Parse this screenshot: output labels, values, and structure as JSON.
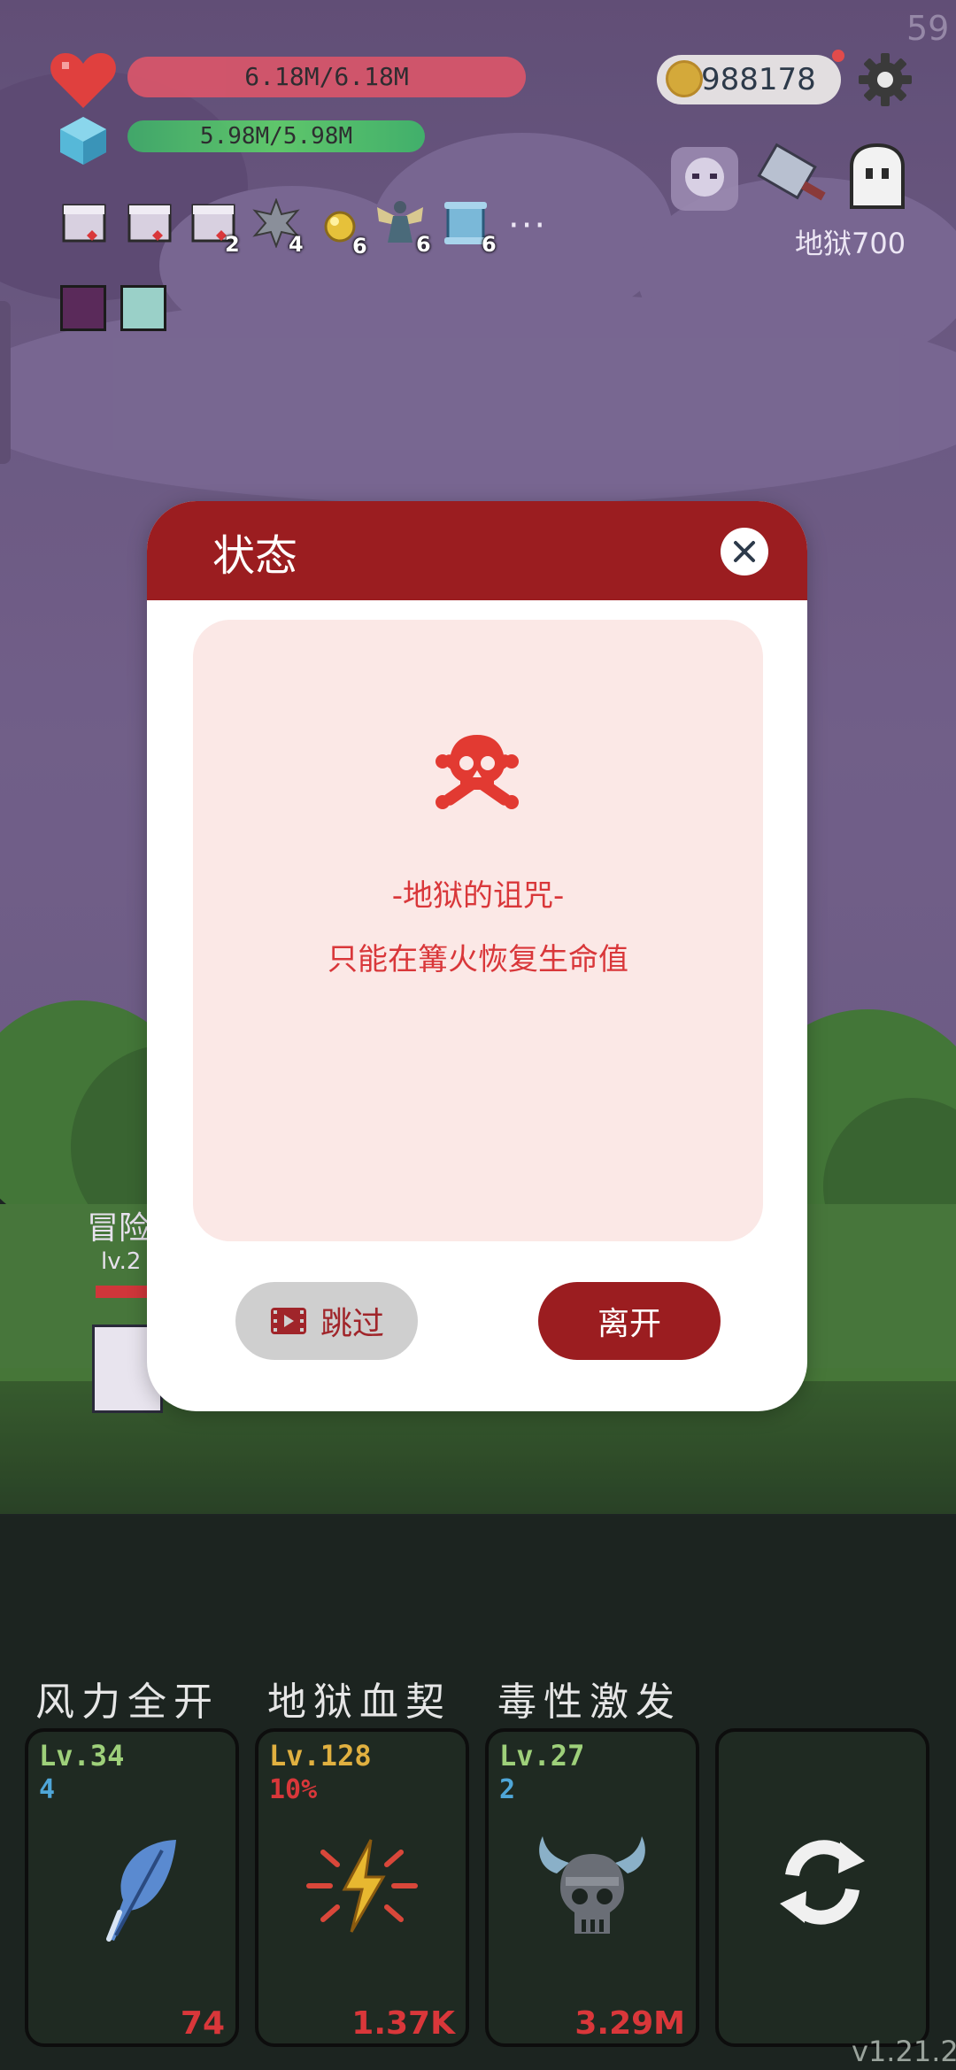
{
  "hud": {
    "hp_text": "6.18M/6.18M",
    "mp_text": "5.98M/5.98M",
    "gold": "988178",
    "fps": "59",
    "status_icons": [
      {
        "icon": "scroll-red-bow-icon",
        "count": ""
      },
      {
        "icon": "scroll-red-bow-icon",
        "count": ""
      },
      {
        "icon": "scroll-red-bow-icon",
        "count": "2"
      },
      {
        "icon": "spiked-ball-icon",
        "count": "4"
      },
      {
        "icon": "sun-orb-icon",
        "count": "6"
      },
      {
        "icon": "winged-figure-icon",
        "count": "6"
      },
      {
        "icon": "blue-scroll-icon",
        "count": "6"
      }
    ],
    "more_indicator": "···",
    "hell_level": "地狱700"
  },
  "player": {
    "name": "冒险",
    "level": "lv.2"
  },
  "dialog": {
    "title": "状态",
    "curse_title": "-地狱的诅咒-",
    "curse_desc": "只能在篝火恢复生命值",
    "skip_label": "跳过",
    "leave_label": "离开"
  },
  "skills": [
    {
      "name": "风力全开",
      "level": "Lv.34",
      "sub": "4",
      "value": "74",
      "icon": "feather-icon",
      "level_color": "#9ed07a",
      "sub_color": "#4fa6d8"
    },
    {
      "name": "地狱血契",
      "level": "Lv.128",
      "sub": "10%",
      "value": "1.37K",
      "icon": "lightning-burst-icon",
      "level_color": "#e0b040",
      "sub_color": "#d9373a"
    },
    {
      "name": "毒性激发",
      "level": "Lv.27",
      "sub": "2",
      "value": "3.29M",
      "icon": "horned-skull-icon",
      "level_color": "#9ed07a",
      "sub_color": "#4fa6d8"
    }
  ],
  "refresh_icon": "refresh-icon",
  "version": "v1.21.2",
  "colors": {
    "dialog_header": "#9b1d20",
    "curse_text": "#d9373a",
    "hp_bar": "#d9566a",
    "mp_bar": "#5fd06a"
  }
}
